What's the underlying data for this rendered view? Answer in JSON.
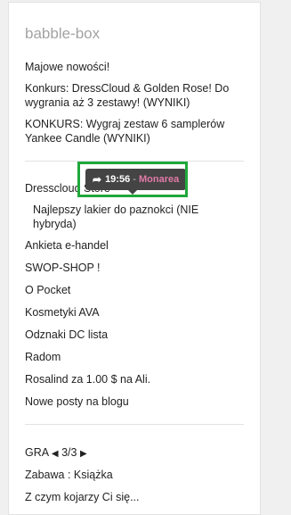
{
  "widget": {
    "title": "babble-box"
  },
  "recent_posts": [
    {
      "label": "Majowe nowości!"
    },
    {
      "label": "Konkurs: DressCloud & Golden Rose! Do wygrania aż 3 zestawy! (WYNIKI)"
    },
    {
      "label": "KONKURS: Wygraj zestaw 6 samplerów Yankee Candle (WYNIKI)"
    }
  ],
  "forum_topics": {
    "first": "Dresscloud Store",
    "indented": "Najlepszy lakier do paznokci (NIE hybryda)",
    "items": [
      "Ankieta e-handel",
      "SWOP-SHOP !",
      "O Pocket",
      "Kosmetyki AVA",
      "Odznaki DC lista",
      "Radom",
      "Rosalind za 1.00 $ na Ali.",
      "Nowe posty na blogu"
    ]
  },
  "tooltip": {
    "icon": "share-icon",
    "time": "19:56",
    "separator": "-",
    "author": "Monarea"
  },
  "game": {
    "label": "GRA",
    "prev_glyph": "◀",
    "page": "3/3",
    "next_glyph": "▶",
    "items": [
      "Zabawa : Książka",
      "Z czym kojarzy Ci się..."
    ]
  },
  "colors": {
    "highlight": "#1fa83a",
    "author": "#e07aa7",
    "tooltip_bg": "#444444"
  }
}
